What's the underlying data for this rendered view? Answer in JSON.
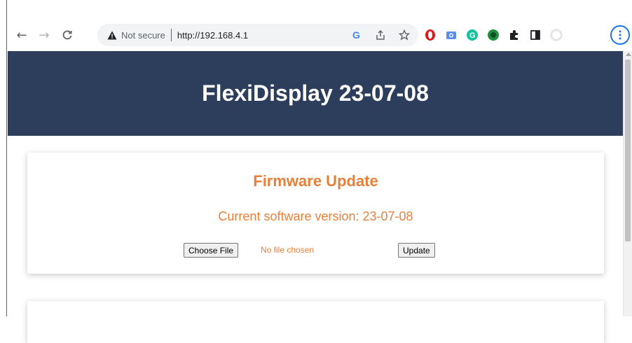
{
  "browser": {
    "nav": {
      "back": "←",
      "forward": "→",
      "reload": "C"
    },
    "address_bar": {
      "security_label": "Not secure",
      "url": "http://192.168.4.1"
    },
    "omnibox_icons": [
      "google-g-icon",
      "share-icon",
      "star-icon"
    ],
    "extension_icons": [
      "opera-icon",
      "camera-extension-icon",
      "grammarly-icon",
      "green-extension-icon",
      "puzzle-icon",
      "side-panel-icon",
      "profile-avatar-icon"
    ],
    "colors": {
      "menu_ring": "#1a73e8"
    }
  },
  "page": {
    "header": {
      "title": "FlexiDisplay 23-07-08",
      "background": "#2d3e5c"
    },
    "firmware_card": {
      "title": "Firmware Update",
      "version_text": "Current software version: 23-07-08",
      "choose_file_label": "Choose File",
      "no_file_text": "No file chosen",
      "update_label": "Update",
      "accent": "#e8803a"
    }
  }
}
